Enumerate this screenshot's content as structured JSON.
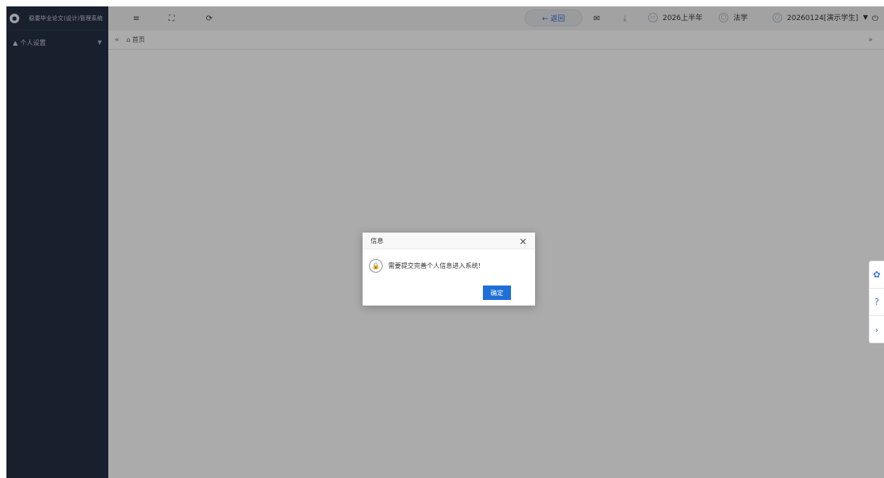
{
  "app": {
    "title": "稳委毕业论文(设计)管理系统",
    "logo_icon": "graduation-cap"
  },
  "sidebar": {
    "items": [
      {
        "label": "个人设置",
        "icon": "user-icon"
      }
    ]
  },
  "header": {
    "menu_icon": "≡",
    "fullscreen_icon": "⛶",
    "refresh_icon": "⟳",
    "back_label": "← 返回",
    "mail_icon": "✉",
    "download_icon": "⤓",
    "semester": "2026上半年",
    "major": "法学",
    "user": "20260124[演示学生]",
    "user_caret": "▼",
    "power_icon": "⏻"
  },
  "tabs": {
    "prev": "«",
    "home_label": "首页",
    "next": "»"
  },
  "dialog": {
    "title": "信息",
    "close": "×",
    "message": "需要提交完善个人信息进入系统!",
    "ok_label": "确定"
  },
  "side_tools": {
    "chat": "✿",
    "help": "?",
    "collapse": "›"
  },
  "colors": {
    "sidebar": "#253144",
    "accent": "#1e6fd9",
    "header": "#f2f2f2"
  }
}
